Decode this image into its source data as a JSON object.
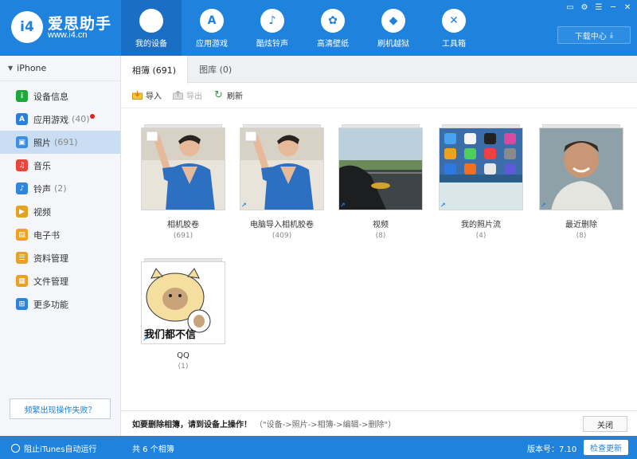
{
  "brand": {
    "logo_text": "i4",
    "name": "爱思助手",
    "url": "www.i4.cn"
  },
  "nav": [
    {
      "label": "我的设备",
      "icon": "apple-icon",
      "glyph": "",
      "active": true
    },
    {
      "label": "应用游戏",
      "icon": "app-store-icon",
      "glyph": "A"
    },
    {
      "label": "酷炫铃声",
      "icon": "bell-icon",
      "glyph": "♪"
    },
    {
      "label": "高清壁纸",
      "icon": "flower-icon",
      "glyph": "✿"
    },
    {
      "label": "刷机越狱",
      "icon": "dropbox-icon",
      "glyph": "◆"
    },
    {
      "label": "工具箱",
      "icon": "tools-icon",
      "glyph": "✕"
    }
  ],
  "download_center": {
    "label": "下载中心",
    "icon": "download-icon"
  },
  "window_buttons": [
    "▭",
    "⚙",
    "☰",
    "─",
    "✕"
  ],
  "sidebar": {
    "device": "iPhone",
    "items": [
      {
        "label": "设备信息",
        "icon": "info-icon",
        "color": "#1fa83a",
        "glyph": "i"
      },
      {
        "label": "应用游戏",
        "count": "(40)",
        "badge": true,
        "icon": "app-store-icon",
        "color": "#2c7fd8",
        "glyph": "A"
      },
      {
        "label": "照片",
        "count": "(691)",
        "active": true,
        "icon": "photo-icon",
        "color": "#3a8fe0",
        "glyph": "▣"
      },
      {
        "label": "音乐",
        "icon": "music-icon",
        "color": "#e8463d",
        "glyph": "♫"
      },
      {
        "label": "铃声",
        "count": "(2)",
        "icon": "bell-icon",
        "color": "#2f86dc",
        "glyph": "♪"
      },
      {
        "label": "视频",
        "icon": "video-icon",
        "color": "#e3a221",
        "glyph": "▶"
      },
      {
        "label": "电子书",
        "icon": "book-icon",
        "color": "#f0a225",
        "glyph": "▤"
      },
      {
        "label": "资料管理",
        "icon": "data-icon",
        "color": "#e5a229",
        "glyph": "☰"
      },
      {
        "label": "文件管理",
        "icon": "file-icon",
        "color": "#e8a224",
        "glyph": "▦"
      },
      {
        "label": "更多功能",
        "icon": "grid-icon",
        "color": "#2e84d8",
        "glyph": "⊞"
      }
    ],
    "fail_button": "频繁出现操作失败？"
  },
  "tabs": [
    {
      "label": "相簿 (691)",
      "active": true
    },
    {
      "label": "图库 (0)"
    }
  ],
  "toolbar": {
    "import": "导入",
    "export": "导出",
    "refresh": "刷新"
  },
  "albums": [
    {
      "name": "相机胶卷",
      "count": "(691)",
      "thumb": "person-blue"
    },
    {
      "name": "电脑导入相机胶卷",
      "count": "(409)",
      "thumb": "person-blue",
      "synced": true
    },
    {
      "name": "视频",
      "count": "(8)",
      "thumb": "road",
      "synced": true
    },
    {
      "name": "我的照片流",
      "count": "(4)",
      "thumb": "homescreen",
      "synced": true
    },
    {
      "name": "最近删除",
      "count": "(8)",
      "thumb": "person-smile",
      "synced": true
    },
    {
      "name": "QQ",
      "count": "(1)",
      "thumb": "meme",
      "synced": true,
      "meme_text": "我们都不信"
    }
  ],
  "footer": {
    "notice": "如要删除相簿，请到设备上操作！",
    "path": "（\"设备->照片->相簿->编辑->删除\"）",
    "close": "关闭"
  },
  "status": {
    "itunes": "阻止iTunes自动运行",
    "total": "共 6 个相簿",
    "version": "版本号：7.10",
    "update": "检查更新"
  }
}
